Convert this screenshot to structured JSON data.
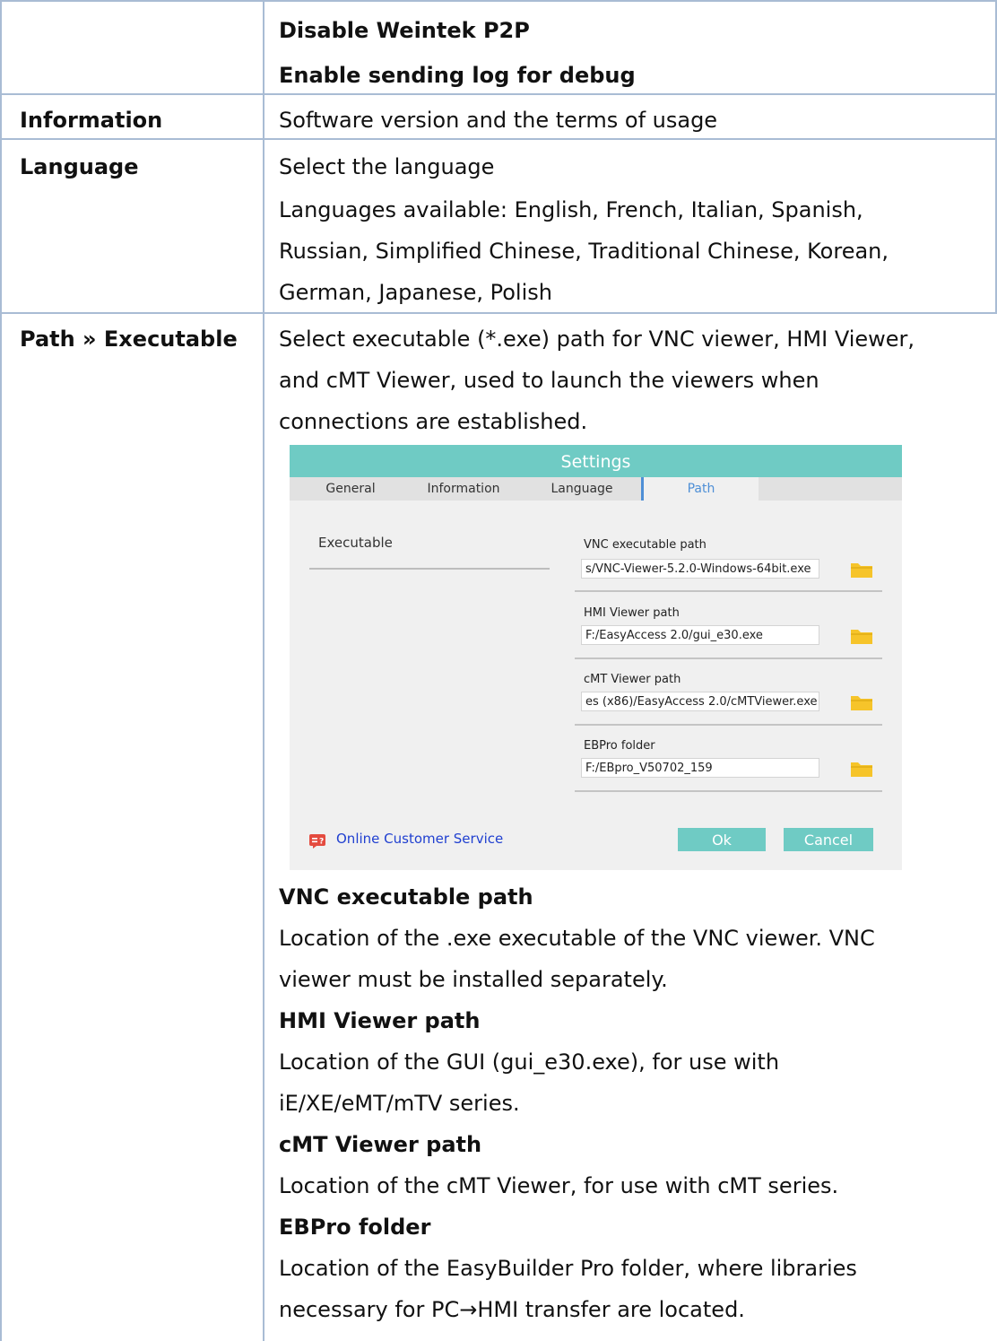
{
  "rows": {
    "options": {
      "items": [
        "Disable Weintek P2P",
        "Enable sending log for debug"
      ]
    },
    "information": {
      "label": "Information",
      "text": "Software version and the terms of usage"
    },
    "language": {
      "label": "Language",
      "lines": [
        "Select the language",
        "Languages available: English, French, Italian, Spanish,",
        "Russian, Simplified Chinese, Traditional Chinese, Korean,",
        "German, Japanese, Polish"
      ]
    },
    "path": {
      "label": "Path » Executable",
      "intro_lines": [
        "Select executable (*.exe) path for VNC viewer, HMI Viewer,",
        "and cMT Viewer, used to launch the viewers when",
        "connections are established."
      ],
      "descriptions": [
        {
          "title": "VNC executable path",
          "lines": [
            "Location of the .exe executable of the VNC viewer. VNC",
            "viewer must be installed separately."
          ]
        },
        {
          "title": "HMI Viewer path",
          "lines": [
            "Location of the GUI (gui_e30.exe), for use with",
            "iE/XE/eMT/mTV series."
          ]
        },
        {
          "title": "cMT Viewer path",
          "lines": [
            "Location of the cMT Viewer, for use with cMT series."
          ]
        },
        {
          "title": "EBPro folder",
          "lines": [
            "Location of the EasyBuilder Pro folder, where libraries",
            "necessary for PC→HMI transfer are located."
          ]
        }
      ]
    }
  },
  "dialog": {
    "title": "Settings",
    "tabs": [
      "General",
      "Information",
      "Language",
      "Path"
    ],
    "active_tab": "Path",
    "section_label": "Executable",
    "fields": [
      {
        "label": "VNC executable path",
        "value": "s/VNC-Viewer-5.2.0-Windows-64bit.exe"
      },
      {
        "label": "HMI Viewer path",
        "value": "F:/EasyAccess 2.0/gui_e30.exe"
      },
      {
        "label": "cMT Viewer path",
        "value": "es (x86)/EasyAccess 2.0/cMTViewer.exe"
      },
      {
        "label": "EBPro folder",
        "value": "F:/EBpro_V50702_159"
      }
    ],
    "online_service": "Online Customer Service",
    "ok_label": "Ok",
    "cancel_label": "Cancel",
    "colors": {
      "accent": "#6fcbc4",
      "link": "#1f3fd0",
      "folder": "#f6c42a",
      "tab_active": "#4e8fd6"
    }
  }
}
